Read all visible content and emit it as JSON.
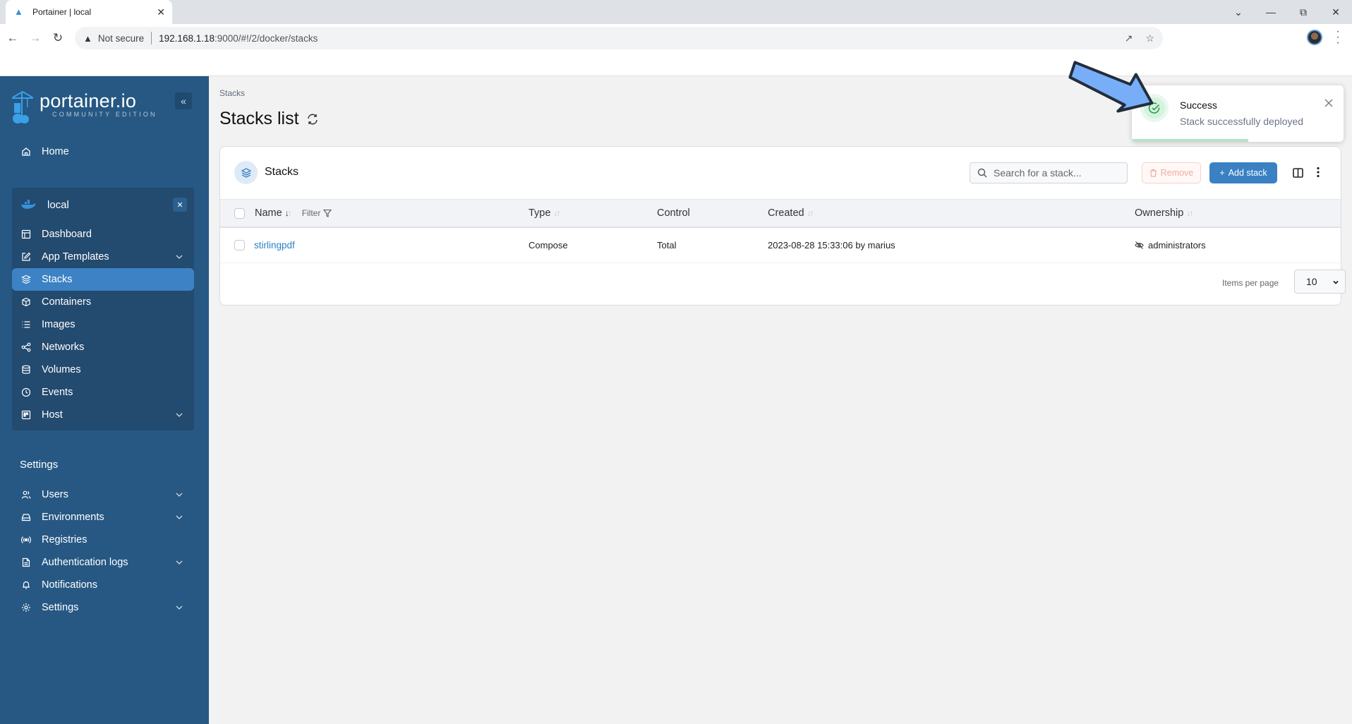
{
  "browser": {
    "tab_title": "Portainer | local",
    "security_label": "Not secure",
    "url_host": "192.168.1.18",
    "url_path": ":9000/#!/2/docker/stacks"
  },
  "sidebar": {
    "brand_name": "portainer.io",
    "brand_edition": "COMMUNITY EDITION",
    "home_label": "Home",
    "environment": {
      "name": "local",
      "items": [
        {
          "label": "Dashboard",
          "icon": "dashboard-icon",
          "has_chevron": false,
          "active": false
        },
        {
          "label": "App Templates",
          "icon": "edit-icon",
          "has_chevron": true,
          "active": false
        },
        {
          "label": "Stacks",
          "icon": "layers-icon",
          "has_chevron": false,
          "active": true
        },
        {
          "label": "Containers",
          "icon": "box-icon",
          "has_chevron": false,
          "active": false
        },
        {
          "label": "Images",
          "icon": "list-icon",
          "has_chevron": false,
          "active": false
        },
        {
          "label": "Networks",
          "icon": "share-icon",
          "has_chevron": false,
          "active": false
        },
        {
          "label": "Volumes",
          "icon": "database-icon",
          "has_chevron": false,
          "active": false
        },
        {
          "label": "Events",
          "icon": "clock-icon",
          "has_chevron": false,
          "active": false
        },
        {
          "label": "Host",
          "icon": "host-icon",
          "has_chevron": true,
          "active": false
        }
      ]
    },
    "settings_heading": "Settings",
    "settings_items": [
      {
        "label": "Users",
        "icon": "users-icon",
        "has_chevron": true
      },
      {
        "label": "Environments",
        "icon": "hdd-icon",
        "has_chevron": true
      },
      {
        "label": "Registries",
        "icon": "radio-icon",
        "has_chevron": false
      },
      {
        "label": "Authentication logs",
        "icon": "file-text-icon",
        "has_chevron": true
      },
      {
        "label": "Notifications",
        "icon": "bell-icon",
        "has_chevron": false
      },
      {
        "label": "Settings",
        "icon": "gear-icon",
        "has_chevron": true
      }
    ]
  },
  "main": {
    "breadcrumb": "Stacks",
    "title": "Stacks list",
    "card_title": "Stacks",
    "search_placeholder": "Search for a stack...",
    "remove_label": "Remove",
    "add_label": "Add stack",
    "columns": {
      "name": "Name",
      "filter": "Filter",
      "type": "Type",
      "control": "Control",
      "created": "Created",
      "ownership": "Ownership"
    },
    "rows": [
      {
        "name": "stirlingpdf",
        "type": "Compose",
        "control": "Total",
        "created": "2023-08-28 15:33:06 by marius",
        "ownership": "administrators"
      }
    ],
    "items_per_page_label": "Items per page",
    "items_per_page_value": "10"
  },
  "toast": {
    "title": "Success",
    "message": "Stack successfully deployed",
    "remaining_fraction": 0.55,
    "accent": "#2e9e50"
  },
  "colors": {
    "sidebar_bg": "#265883",
    "sidebar_active": "#3c82c5",
    "primary": "#3a81c4",
    "link": "#2b82c8"
  }
}
